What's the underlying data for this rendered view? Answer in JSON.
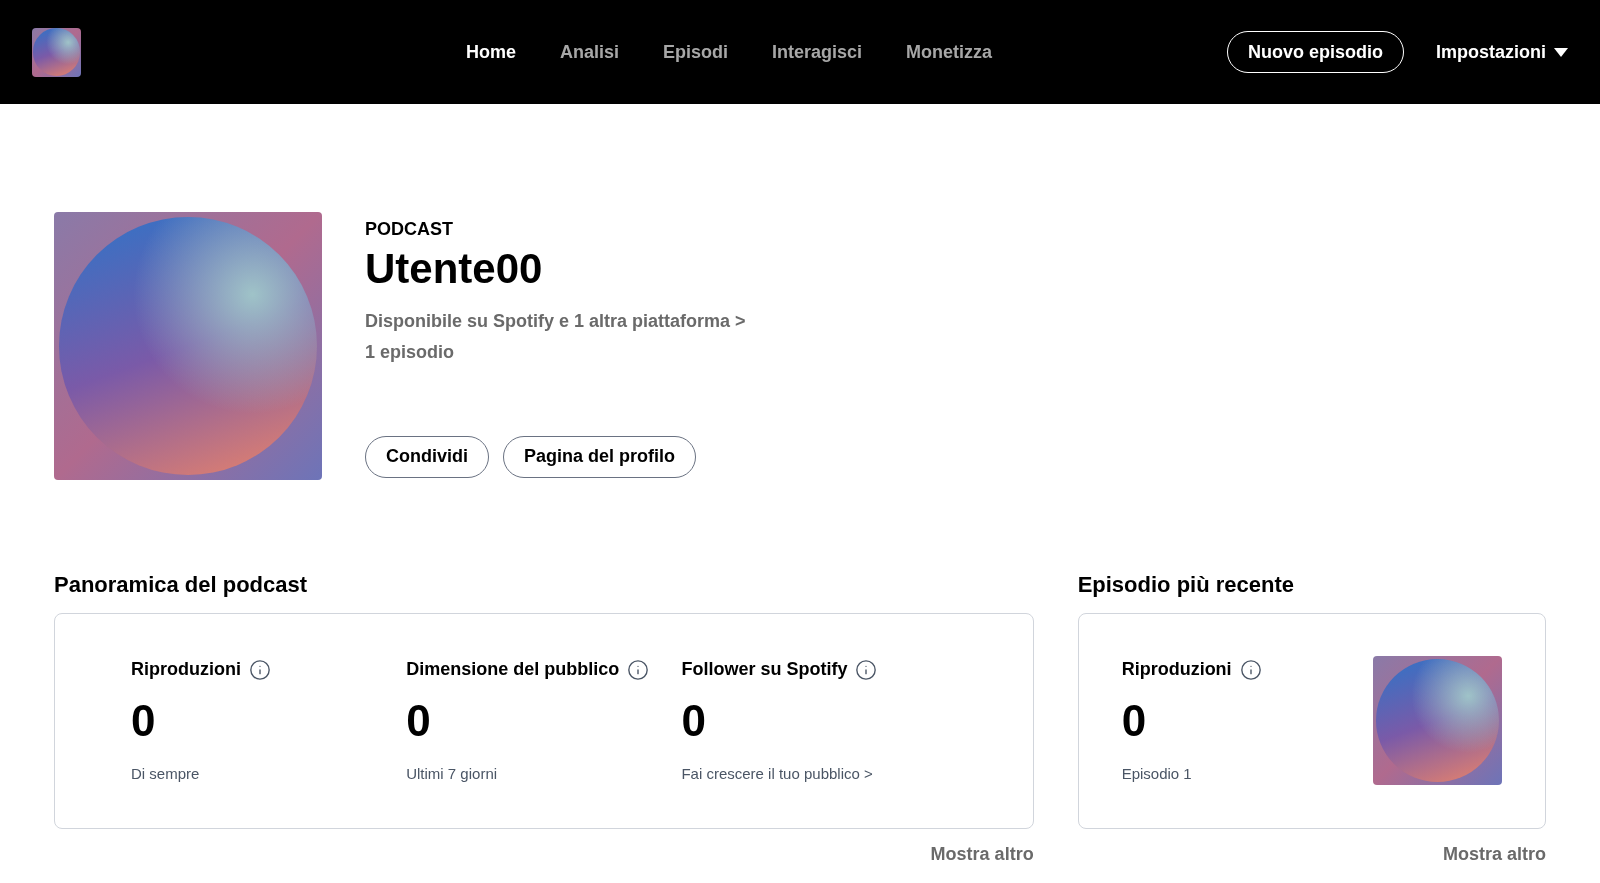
{
  "header": {
    "nav": [
      {
        "label": "Home",
        "selected": true
      },
      {
        "label": "Analisi",
        "selected": false
      },
      {
        "label": "Episodi",
        "selected": false
      },
      {
        "label": "Interagisci",
        "selected": false
      },
      {
        "label": "Monetizza",
        "selected": false
      }
    ],
    "new_episode_button": "Nuovo episodio",
    "settings_menu": "Impostazioni"
  },
  "podcast": {
    "type_label": "PODCAST",
    "title": "Utente00",
    "availability_link": "Disponibile su Spotify e 1 altra piattaforma >",
    "episode_count": "1 episodio",
    "buttons": [
      "Condividi",
      "Pagina del profilo"
    ]
  },
  "overview": {
    "title": "Panoramica del podcast",
    "stats": [
      {
        "label": "Riproduzioni",
        "value": "0",
        "caption": "Di sempre"
      },
      {
        "label": "Dimensione del pubblico",
        "value": "0",
        "caption": "Ultimi 7 giorni"
      },
      {
        "label": "Follower su Spotify",
        "value": "0",
        "caption": "Fai crescere il tuo pubblico >"
      }
    ],
    "more": "Mostra altro"
  },
  "latest_episode": {
    "title": "Episodio più recente",
    "stat": {
      "label": "Riproduzioni",
      "value": "0",
      "caption": "Episodio 1"
    },
    "more": "Mostra altro"
  }
}
